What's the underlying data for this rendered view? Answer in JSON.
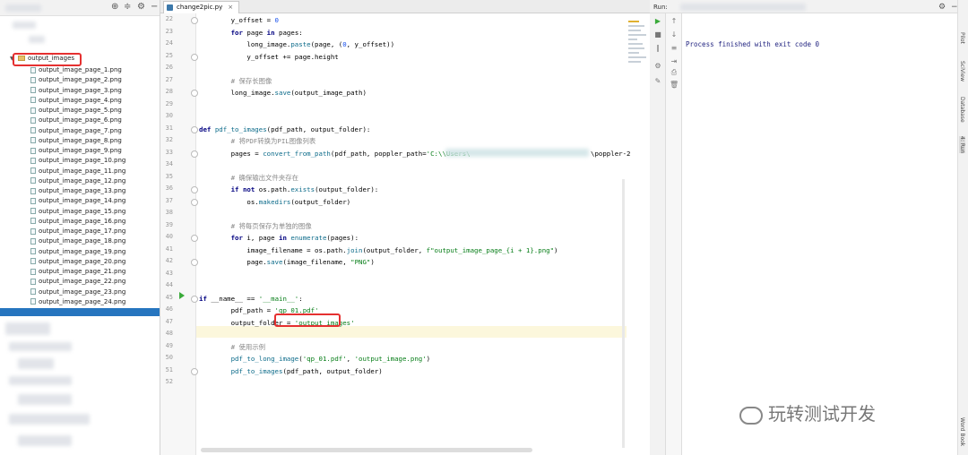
{
  "project": {
    "folder_name": "output_images",
    "files": [
      "output_image_page_1.png",
      "output_image_page_2.png",
      "output_image_page_3.png",
      "output_image_page_4.png",
      "output_image_page_5.png",
      "output_image_page_6.png",
      "output_image_page_7.png",
      "output_image_page_8.png",
      "output_image_page_9.png",
      "output_image_page_10.png",
      "output_image_page_11.png",
      "output_image_page_12.png",
      "output_image_page_13.png",
      "output_image_page_14.png",
      "output_image_page_15.png",
      "output_image_page_16.png",
      "output_image_page_17.png",
      "output_image_page_18.png",
      "output_image_page_19.png",
      "output_image_page_20.png",
      "output_image_page_21.png",
      "output_image_page_22.png",
      "output_image_page_23.png",
      "output_image_page_24.png"
    ],
    "toolbar_icons": [
      "locate-icon",
      "collapse-icon",
      "gear-icon",
      "minimize-icon"
    ]
  },
  "editor": {
    "tab_label": "change2pic.py",
    "tab_close": "×",
    "lines": [
      {
        "n": "22",
        "code": [
          [
            "",
            "        y_offset = "
          ],
          [
            "nm",
            "0"
          ]
        ]
      },
      {
        "n": "23",
        "code": [
          [
            "",
            "        "
          ],
          [
            "kw",
            "for"
          ],
          [
            "",
            " page "
          ],
          [
            "kw",
            "in"
          ],
          [
            "",
            " pages:"
          ]
        ]
      },
      {
        "n": "24",
        "code": [
          [
            "",
            "            long_image."
          ],
          [
            "fn",
            "paste"
          ],
          [
            "",
            "(page, ("
          ],
          [
            "nm",
            "0"
          ],
          [
            "",
            ", y_offset))"
          ]
        ]
      },
      {
        "n": "25",
        "code": [
          [
            "",
            "            y_offset += page.height"
          ]
        ]
      },
      {
        "n": "26",
        "code": []
      },
      {
        "n": "27",
        "code": [
          [
            "cm",
            "        # 保存长图像"
          ]
        ]
      },
      {
        "n": "28",
        "code": [
          [
            "",
            "        long_image."
          ],
          [
            "fn",
            "save"
          ],
          [
            "",
            "(output_image_path)"
          ]
        ]
      },
      {
        "n": "29",
        "code": []
      },
      {
        "n": "30",
        "code": []
      },
      {
        "n": "31",
        "code": [
          [
            "kw",
            "def"
          ],
          [
            "",
            " "
          ],
          [
            "fn",
            "pdf_to_images"
          ],
          [
            "",
            "(pdf_path, output_folder):"
          ]
        ]
      },
      {
        "n": "32",
        "code": [
          [
            "cm",
            "        # 将PDF转换为PIL图像列表"
          ]
        ]
      },
      {
        "n": "33",
        "code": [
          [
            "",
            "        pages = "
          ],
          [
            "fn",
            "convert_from_path"
          ],
          [
            "",
            "(pdf_path, poppler_path="
          ],
          [
            "st",
            "'C:\\\\Users\\"
          ]
        ]
      },
      {
        "n": "34",
        "code": []
      },
      {
        "n": "35",
        "code": [
          [
            "cm",
            "        # 确保输出文件夹存在"
          ]
        ]
      },
      {
        "n": "36",
        "code": [
          [
            "",
            "        "
          ],
          [
            "kw",
            "if not"
          ],
          [
            "",
            " os.path."
          ],
          [
            "fn",
            "exists"
          ],
          [
            "",
            "(output_folder):"
          ]
        ]
      },
      {
        "n": "37",
        "code": [
          [
            "",
            "            os."
          ],
          [
            "fn",
            "makedirs"
          ],
          [
            "",
            "(output_folder)"
          ]
        ]
      },
      {
        "n": "38",
        "code": []
      },
      {
        "n": "39",
        "code": [
          [
            "cm",
            "        # 将每页保存为单独的图像"
          ]
        ]
      },
      {
        "n": "40",
        "code": [
          [
            "",
            "        "
          ],
          [
            "kw",
            "for"
          ],
          [
            "",
            " i, page "
          ],
          [
            "kw",
            "in"
          ],
          [
            "",
            " "
          ],
          [
            "fn",
            "enumerate"
          ],
          [
            "",
            "(pages):"
          ]
        ]
      },
      {
        "n": "41",
        "code": [
          [
            "",
            "            image_filename = os.path."
          ],
          [
            "fn",
            "join"
          ],
          [
            "",
            "(output_folder, "
          ],
          [
            "st",
            "f\"output_image_page_{i + 1}.png\""
          ],
          [
            "",
            ")"
          ]
        ]
      },
      {
        "n": "42",
        "code": [
          [
            "",
            "            page."
          ],
          [
            "fn",
            "save"
          ],
          [
            "",
            "(image_filename, "
          ],
          [
            "st",
            "\"PNG\""
          ],
          [
            "",
            ")"
          ]
        ]
      },
      {
        "n": "43",
        "code": []
      },
      {
        "n": "44",
        "code": []
      },
      {
        "n": "45",
        "code": [
          [
            "kw",
            "if"
          ],
          [
            "",
            " __name__ == "
          ],
          [
            "st",
            "'__main__'"
          ],
          [
            "",
            ":"
          ]
        ]
      },
      {
        "n": "46",
        "code": [
          [
            "",
            "        pdf_path = "
          ],
          [
            "st",
            "'qp_01.pdf'"
          ]
        ]
      },
      {
        "n": "47",
        "code": [
          [
            "",
            "        output_folder = "
          ],
          [
            "st",
            "'output_images'"
          ]
        ]
      },
      {
        "n": "48",
        "code": []
      },
      {
        "n": "49",
        "code": [
          [
            "cm",
            "        # 使用示例"
          ]
        ]
      },
      {
        "n": "50",
        "code": [
          [
            "",
            "        "
          ],
          [
            "fn",
            "pdf_to_long_image"
          ],
          [
            "",
            "("
          ],
          [
            "st",
            "'qp_01.pdf'"
          ],
          [
            "",
            ", "
          ],
          [
            "st",
            "'output_image.png'"
          ],
          [
            "",
            ")"
          ]
        ]
      },
      {
        "n": "51",
        "code": [
          [
            "",
            "        "
          ],
          [
            "fn",
            "pdf_to_images"
          ],
          [
            "",
            "(pdf_path, output_folder)"
          ]
        ]
      },
      {
        "n": "52",
        "code": []
      }
    ],
    "line33_tail": "\\poppler-2"
  },
  "run": {
    "label": "Run:",
    "output": "Process finished with exit code 0",
    "side_tabs": [
      "Pilot",
      "SciView",
      "Database",
      "4: Run",
      "Word Book"
    ]
  },
  "watermark": "玩转测试开发",
  "colors": {
    "accent": "#2675bf",
    "highlight": "#fcf7dc",
    "redbox": "#e53030"
  }
}
